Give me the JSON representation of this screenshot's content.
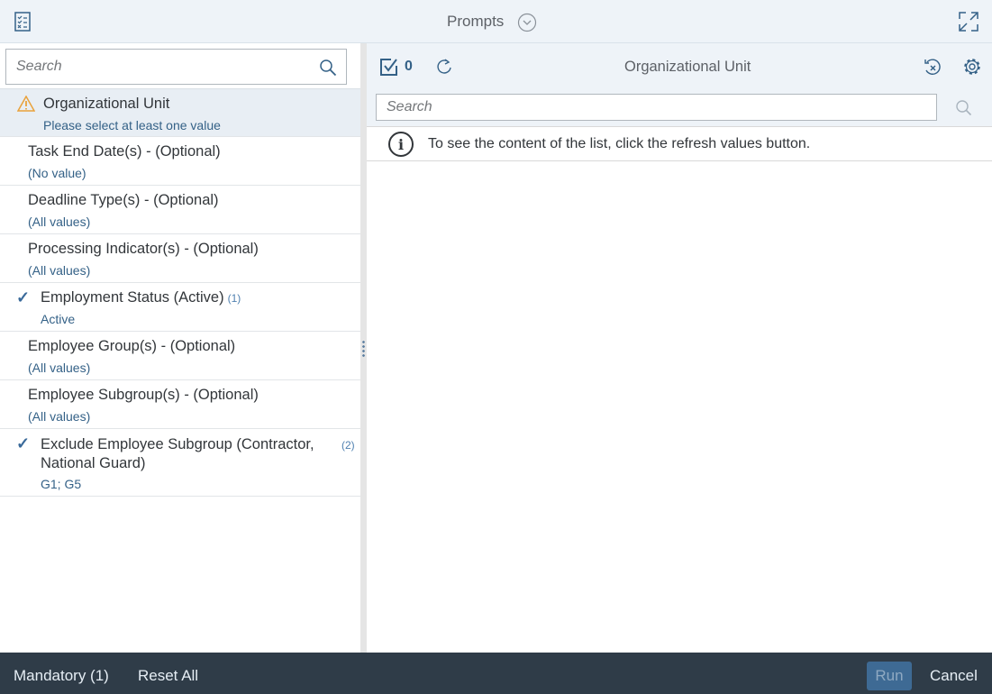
{
  "header": {
    "title": "Prompts"
  },
  "left": {
    "search_placeholder": "Search",
    "items": [
      {
        "title": "Organizational Unit",
        "value": "Please select at least one value",
        "status": "warning"
      },
      {
        "title": "Task End Date(s) - (Optional)",
        "value": "(No value)"
      },
      {
        "title": "Deadline Type(s) - (Optional)",
        "value": "(All values)"
      },
      {
        "title": "Processing Indicator(s) - (Optional)",
        "value": "(All values)"
      },
      {
        "title": "Employment Status (Active)",
        "count": "(1)",
        "value": "Active",
        "checked": true
      },
      {
        "title": "Employee Group(s) - (Optional)",
        "value": "(All values)"
      },
      {
        "title": "Employee Subgroup(s) - (Optional)",
        "value": "(All values)"
      },
      {
        "title": "Exclude Employee Subgroup (Contractor, National Guard)",
        "count": "(2)",
        "value": "G1; G5",
        "checked": true
      }
    ]
  },
  "right": {
    "selected_count": "0",
    "title": "Organizational Unit",
    "search_placeholder": "Search",
    "info": "To see the content of the list, click the refresh values button."
  },
  "footer": {
    "mandatory": "Mandatory (1)",
    "reset": "Reset All",
    "run": "Run",
    "cancel": "Cancel"
  },
  "colors": {
    "accent": "#346187",
    "footer": "#2f3c48",
    "warning": "#e9a23b"
  }
}
